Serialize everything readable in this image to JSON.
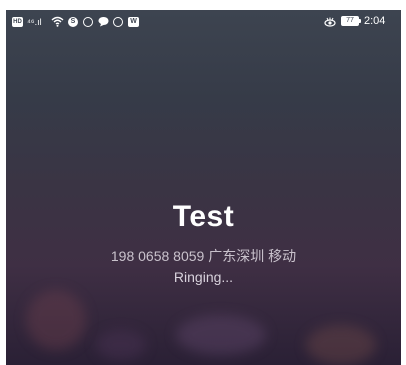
{
  "status_bar": {
    "left_icons": [
      "hd-icon",
      "signal-4g-icon",
      "wifi-icon",
      "app-s-icon",
      "whatsapp-icon",
      "message-icon",
      "hand-icon",
      "app-w-icon"
    ],
    "hd_label": "HD",
    "net_label": "⁴⁶.ıl",
    "battery_level": "77",
    "time": "2:04"
  },
  "call": {
    "caller_name": "Test",
    "number_line": "198 0658 8059 广东深圳 移动",
    "status": "Ringing..."
  },
  "colors": {
    "background_top": "#3d4450",
    "background_bottom": "#2a2035",
    "text_primary": "#ffffff"
  }
}
